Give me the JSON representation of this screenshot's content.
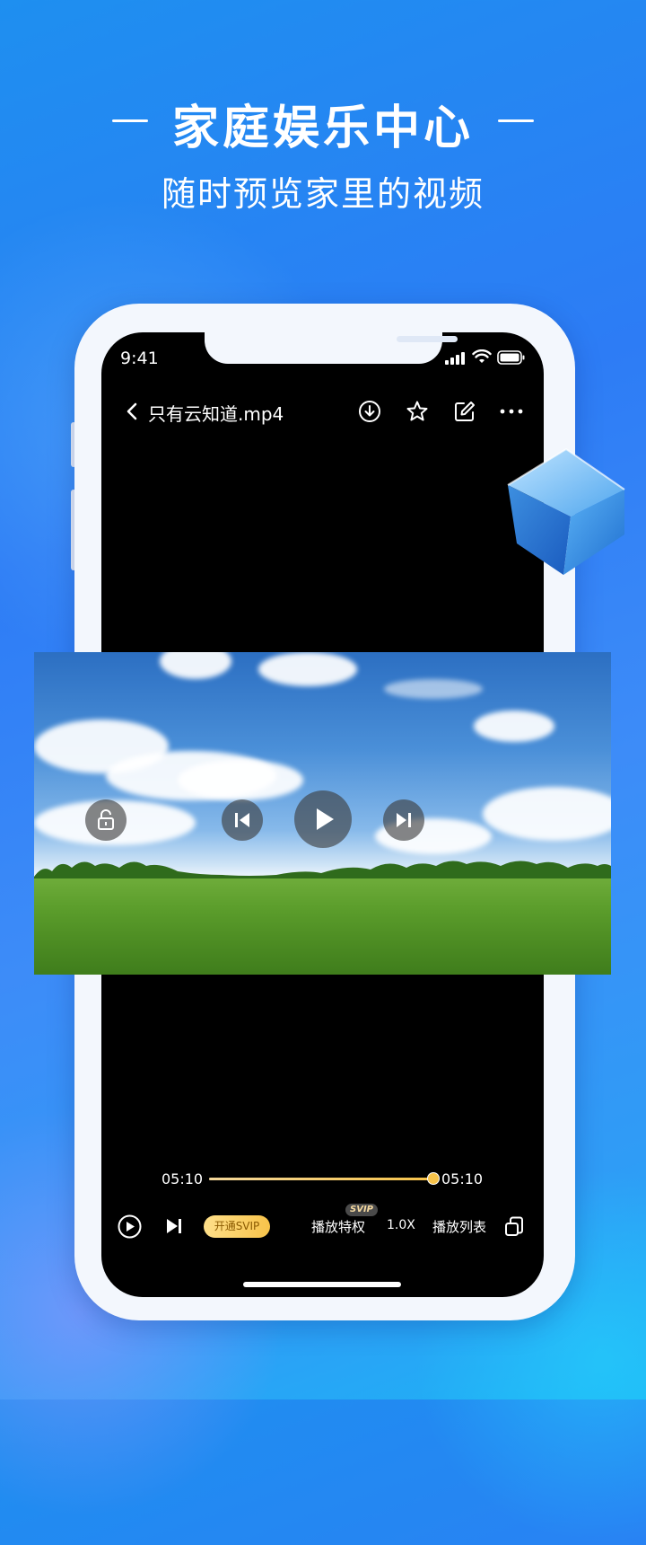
{
  "promo": {
    "headline": "家庭娱乐中心",
    "subheadline": "随时预览家里的视频"
  },
  "status_bar": {
    "time": "9:41"
  },
  "player": {
    "file_title": "只有云知道.mp4",
    "icons": {
      "back": "chevron-left-icon",
      "download": "download-icon",
      "favorite": "star-icon",
      "edit": "edit-icon",
      "more": "more-icon"
    },
    "video_controls": [
      "unlock-icon",
      "previous-icon",
      "play-icon",
      "next-icon"
    ],
    "progress": {
      "current_time": "05:10",
      "total_time": "05:10",
      "fraction": 1.0
    },
    "bottom_bar": {
      "svip_button": "开通SVIP",
      "privilege_label": "播放特权",
      "privilege_badge": "SVIP",
      "speed": "1.0X",
      "playlist": "播放列表"
    }
  },
  "colors": {
    "accent_gold": "#f7c34a",
    "background_blue": "#2d7cf5"
  }
}
